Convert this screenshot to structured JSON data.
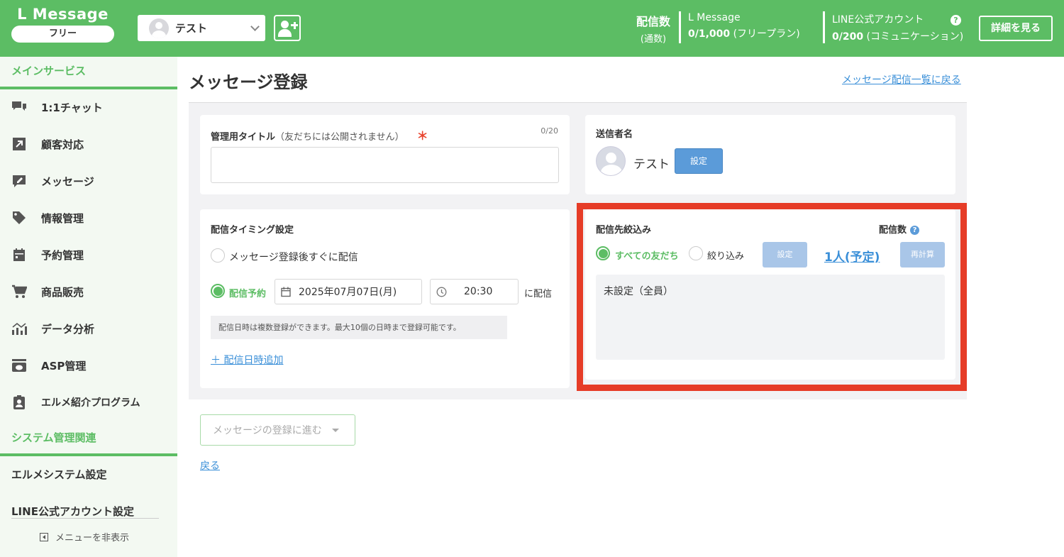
{
  "brand": {
    "name": "L Message",
    "plan": "フリー"
  },
  "account": {
    "name": "テスト"
  },
  "header": {
    "count_title": "配信数",
    "count_unit": "(通数)",
    "lmessage_title": "L Message",
    "lmessage_value": "0/1,000",
    "lmessage_plan": "(フリープラン)",
    "line_title": "LINE公式アカウント",
    "line_value": "0/200",
    "line_plan": "(コミュニケーション)",
    "help": "?",
    "details_label": "詳細を見る"
  },
  "sidebar": {
    "main_section": "メインサービス",
    "items": [
      {
        "label": "1:1チャット",
        "icon": "chat-icon"
      },
      {
        "label": "顧客対応",
        "icon": "arrow-up-right-icon"
      },
      {
        "label": "メッセージ",
        "icon": "edit-message-icon"
      },
      {
        "label": "情報管理",
        "icon": "tag-icon"
      },
      {
        "label": "予約管理",
        "icon": "calendar-icon"
      },
      {
        "label": "商品販売",
        "icon": "cart-icon"
      },
      {
        "label": "データ分析",
        "icon": "chart-icon"
      },
      {
        "label": "ASP管理",
        "icon": "register-icon"
      },
      {
        "label": "エルメ紹介プログラム",
        "icon": "clipboard-user-icon"
      }
    ],
    "system_section": "システム管理関連",
    "system_settings": "エルメシステム設定",
    "line_settings": "LINE公式アカウント設定",
    "hide_menu": "メニューを非表示"
  },
  "main": {
    "title": "メッセージ登録",
    "back_to_list": "メッセージ配信一覧に戻る",
    "admin_title": {
      "label": "管理用タイトル",
      "sub": "（友だちには公開されません）",
      "required": "＊",
      "counter": "0/20",
      "value": ""
    },
    "sender": {
      "label": "送信者名",
      "name": "テスト",
      "set_button": "設定"
    },
    "timing": {
      "label": "配信タイミング設定",
      "immediate": "メッセージ登録後すぐに配信",
      "scheduled": "配信予約",
      "date": "2025年07月07日(月)",
      "time": "20:30",
      "suffix": "に配信",
      "note": "配信日時は複数登録ができます。最大10個の日時まで登録可能です。",
      "add_link": "＋ 配信日時追加"
    },
    "target": {
      "label": "配信先絞込み",
      "count_label": "配信数",
      "help": "?",
      "all_friends": "すべての友だち",
      "filter": "絞り込み",
      "set_button": "設定",
      "count_value": "1人(予定)",
      "recalc_button": "再計算",
      "condition": "未設定（全員）"
    },
    "next_button": "メッセージの登録に進む",
    "back_link": "戻る"
  }
}
